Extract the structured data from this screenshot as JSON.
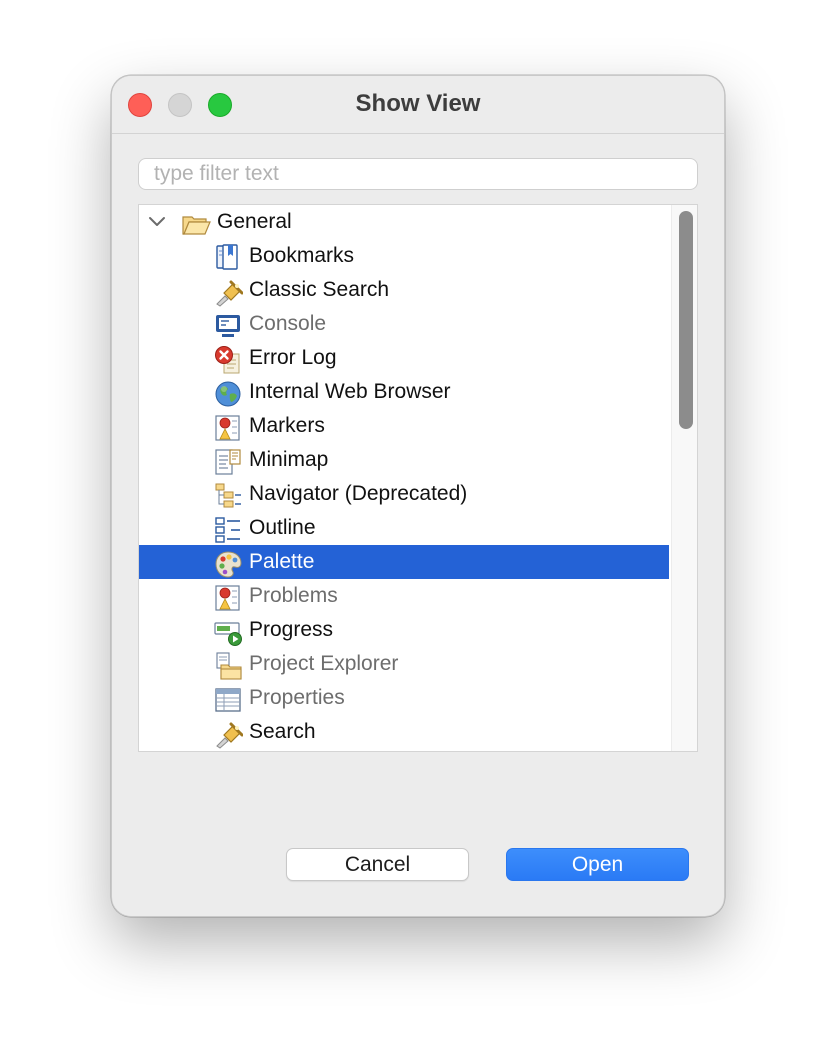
{
  "dialog": {
    "title": "Show View"
  },
  "filter": {
    "placeholder": "type filter text",
    "value": ""
  },
  "tree": {
    "group": {
      "label": "General",
      "expanded": true,
      "icon": "open-folder-icon"
    },
    "items": [
      {
        "label": "Bookmarks",
        "icon": "bookmarks-icon",
        "dimmed": false,
        "selected": false
      },
      {
        "label": "Classic Search",
        "icon": "flashlight-search-icon",
        "dimmed": false,
        "selected": false
      },
      {
        "label": "Console",
        "icon": "console-monitor-icon",
        "dimmed": true,
        "selected": false
      },
      {
        "label": "Error Log",
        "icon": "error-log-icon",
        "dimmed": false,
        "selected": false
      },
      {
        "label": "Internal Web Browser",
        "icon": "globe-icon",
        "dimmed": false,
        "selected": false
      },
      {
        "label": "Markers",
        "icon": "markers-icon",
        "dimmed": false,
        "selected": false
      },
      {
        "label": "Minimap",
        "icon": "minimap-icon",
        "dimmed": false,
        "selected": false
      },
      {
        "label": "Navigator (Deprecated)",
        "icon": "navigator-icon",
        "dimmed": false,
        "selected": false
      },
      {
        "label": "Outline",
        "icon": "outline-icon",
        "dimmed": false,
        "selected": false
      },
      {
        "label": "Palette",
        "icon": "palette-icon",
        "dimmed": false,
        "selected": true
      },
      {
        "label": "Problems",
        "icon": "problems-icon",
        "dimmed": true,
        "selected": false
      },
      {
        "label": "Progress",
        "icon": "progress-icon",
        "dimmed": false,
        "selected": false
      },
      {
        "label": "Project Explorer",
        "icon": "project-explorer-icon",
        "dimmed": true,
        "selected": false
      },
      {
        "label": "Properties",
        "icon": "properties-table-icon",
        "dimmed": true,
        "selected": false
      },
      {
        "label": "Search",
        "icon": "flashlight-search-icon",
        "dimmed": false,
        "selected": false
      }
    ]
  },
  "buttons": {
    "cancel": "Cancel",
    "open": "Open"
  },
  "colors": {
    "selection": "#2462d6",
    "accent_button": "#3d8efc",
    "close": "#fe5f57",
    "zoom": "#28c840"
  }
}
